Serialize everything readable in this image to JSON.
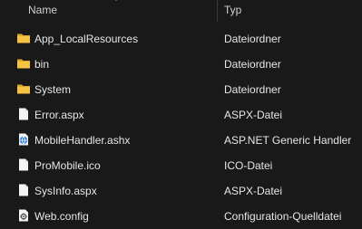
{
  "columns": {
    "name": "Name",
    "type": "Typ"
  },
  "files": [
    {
      "name": "App_LocalResources",
      "type": "Dateiordner",
      "icon": "folder-icon"
    },
    {
      "name": "bin",
      "type": "Dateiordner",
      "icon": "folder-icon"
    },
    {
      "name": "System",
      "type": "Dateiordner",
      "icon": "folder-icon"
    },
    {
      "name": "Error.aspx",
      "type": "ASPX-Datei",
      "icon": "document-icon"
    },
    {
      "name": "MobileHandler.ashx",
      "type": "ASP.NET Generic Handler",
      "icon": "web-handler-icon"
    },
    {
      "name": "ProMobile.ico",
      "type": "ICO-Datei",
      "icon": "document-icon"
    },
    {
      "name": "SysInfo.aspx",
      "type": "ASPX-Datei",
      "icon": "document-icon"
    },
    {
      "name": "Web.config",
      "type": "Configuration-Quelldatei",
      "icon": "config-file-icon"
    }
  ],
  "colors": {
    "folder": "#f6c343",
    "background": "#191919",
    "text": "#e6e6e6"
  }
}
